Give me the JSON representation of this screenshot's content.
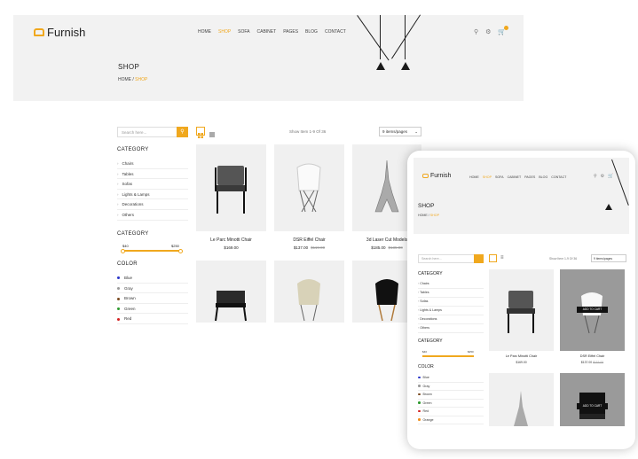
{
  "brand": "Furnish",
  "nav": [
    "HOME",
    "SHOP",
    "SOFA",
    "CABINET",
    "PAGES",
    "BLOG",
    "CONTACT"
  ],
  "nav_active": "SHOP",
  "page_title": "SHOP",
  "breadcrumb": {
    "home": "HOME",
    "sep": "/",
    "current": "SHOP"
  },
  "search": {
    "placeholder": "Search here..."
  },
  "category": {
    "title": "CATEGORY",
    "items": [
      "Chairs",
      "Tables",
      "Sofas",
      "Lights & Lamps",
      "Decorations",
      "Others"
    ]
  },
  "price_filter": {
    "title": "CATEGORY",
    "min_label": "$40",
    "max_label": "$250"
  },
  "color": {
    "title": "COLOR",
    "items": [
      {
        "name": "Blue",
        "hex": "#2a35c9"
      },
      {
        "name": "Gray",
        "hex": "#9a9a9a"
      },
      {
        "name": "Brown",
        "hex": "#7a4a21"
      },
      {
        "name": "Green",
        "hex": "#2f9a2f"
      },
      {
        "name": "Red",
        "hex": "#d42020"
      },
      {
        "name": "Orange",
        "hex": "#f0901e"
      }
    ]
  },
  "showing": "Show Item 1-9 Of 36",
  "per_page": "9 items/pages",
  "products": [
    {
      "name": "Le Parc Minotti Chair",
      "price": "$169.00",
      "old": ""
    },
    {
      "name": "DSR Eiffel Chair",
      "price": "$137.00",
      "old": "$119.00"
    },
    {
      "name": "3d Laser Cut Models",
      "price": "$185.00",
      "old": "$135.00"
    }
  ],
  "add_to_cart": "ADD TO CART",
  "accent": "#f0a81e"
}
